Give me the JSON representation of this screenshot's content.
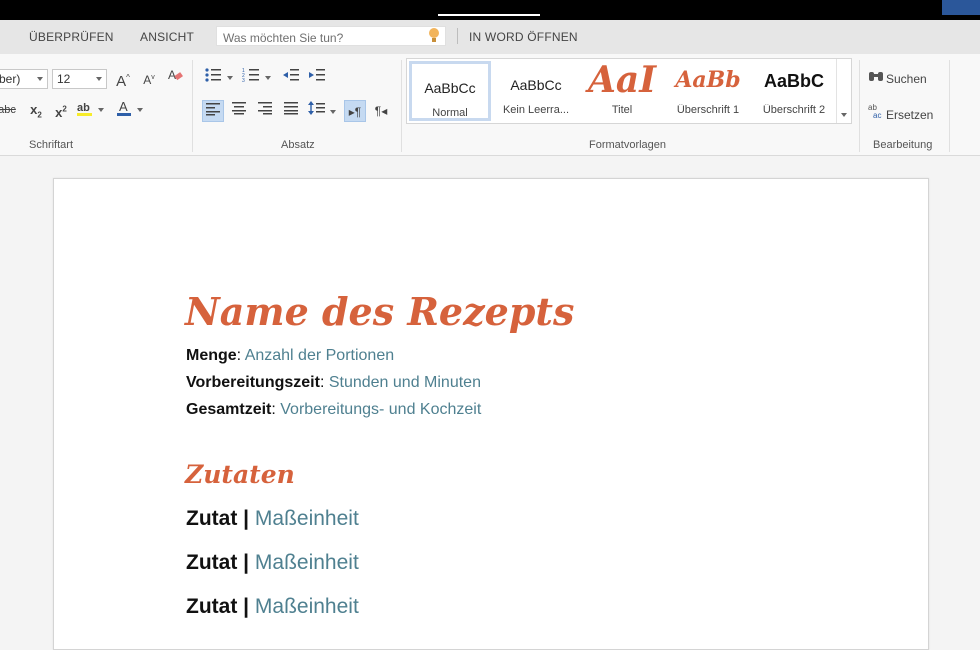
{
  "tabs": {
    "review": "ÜBERPRÜFEN",
    "view": "ANSICHT",
    "tell_me_placeholder": "Was möchten Sie tun?",
    "open_in_word": "IN WORD ÖFFNEN"
  },
  "ribbon": {
    "font_name": "ber)",
    "font_size": "12",
    "groups": {
      "font": "Schriftart",
      "paragraph": "Absatz",
      "styles": "Formatvorlagen",
      "editing": "Bearbeitung"
    },
    "styles": [
      {
        "sample": "AaBbCc",
        "name": "Normal"
      },
      {
        "sample": "AaBbCc",
        "name": "Kein Leerra..."
      },
      {
        "sample": "AaI",
        "name": "Titel"
      },
      {
        "sample": "AaBb",
        "name": "Überschrift 1"
      },
      {
        "sample": "AaBbC",
        "name": "Überschrift 2"
      }
    ],
    "search_label": "Suchen",
    "replace_label": "Ersetzen",
    "colors": {
      "accent_orange": "#d6623c",
      "selected_blue": "#c5daf2"
    }
  },
  "document": {
    "title": "Name des Rezepts",
    "meta": [
      {
        "label": "Menge",
        "value": "Anzahl der Portionen"
      },
      {
        "label": "Vorbereitungszeit",
        "value": "Stunden und Minuten"
      },
      {
        "label": "Gesamtzeit",
        "value": "Vorbereitungs- und Kochzeit"
      }
    ],
    "section_heading": "Zutaten",
    "ingredients": [
      {
        "label": "Zutat",
        "separator": "|",
        "value": "Maßeinheit"
      },
      {
        "label": "Zutat",
        "separator": "|",
        "value": "Maßeinheit"
      },
      {
        "label": "Zutat",
        "separator": "|",
        "value": "Maßeinheit"
      }
    ]
  }
}
